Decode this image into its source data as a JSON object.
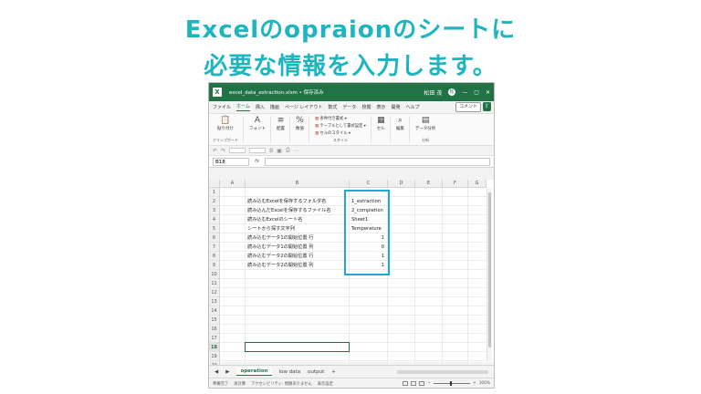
{
  "headline": {
    "line1": "Excelのopraionのシートに",
    "line2": "必要な情報を入力します。"
  },
  "window": {
    "filename": "excel_data_extraction.xlsm • 保存済み",
    "user": "松田 茂",
    "user_badge": "松",
    "controls": [
      "—",
      "▢",
      "✕"
    ]
  },
  "menu": {
    "tabs": [
      "ファイル",
      "ホーム",
      "挿入",
      "描画",
      "ページ レイアウト",
      "数式",
      "データ",
      "校閲",
      "表示",
      "開発",
      "ヘルプ"
    ],
    "active_tab": "ホーム",
    "comment_label": "コメント",
    "share_label": "⇧"
  },
  "ribbon": {
    "clipboard": {
      "group": "クリップボード",
      "paste": "貼り付け"
    },
    "font": {
      "label": "フォント",
      "glyph": "A"
    },
    "align": {
      "label": "配置",
      "glyph": "≡"
    },
    "number": {
      "label": "数値",
      "glyph": "%"
    },
    "styles": {
      "group": "スタイル",
      "items": [
        "条件付き書式 ▾",
        "テーブルとして書式設定 ▾",
        "セルのスタイル ▾"
      ]
    },
    "cells": {
      "label": "セル",
      "glyph": "▦"
    },
    "edit": {
      "label": "編集",
      "glyph": "⌕"
    },
    "analysis": {
      "label": "データ分析",
      "group": "分析",
      "glyph": "▤"
    }
  },
  "formula_bar": {
    "name_box": "B18",
    "fx": "fx",
    "value": ""
  },
  "columns": [
    "A",
    "B",
    "C",
    "D",
    "E",
    "F",
    "G"
  ],
  "rows": [
    "1",
    "2",
    "3",
    "4",
    "5",
    "6",
    "7",
    "8",
    "9",
    "10",
    "11",
    "12",
    "13",
    "14",
    "15",
    "16",
    "17",
    "18",
    "19",
    "20"
  ],
  "cells": {
    "b": [
      "",
      "読み込むExcelを保存するフォルダ名",
      "読み込んだExcelを保存するファイル名",
      "読み込むExcelのシート名",
      "シートから探す文字列",
      "読み込むデータ1の開始位置 行",
      "読み込むデータ1の開始位置 列",
      "読み込むデータ2の開始位置 行",
      "読み込むデータ2の開始位置 列"
    ],
    "c": [
      "",
      "1_extraction",
      "2_completion",
      "Sheet1",
      "Temperature",
      "1",
      "0",
      "1",
      "1"
    ]
  },
  "sheets": {
    "tabs": [
      "operation",
      "low data",
      "output"
    ],
    "active": "operation",
    "add": "+"
  },
  "status": {
    "ready": "準備完了",
    "calc": "再計算",
    "accessibility": "アクセシビリティ: 問題ありません",
    "display": "表示設定",
    "zoom": "100%"
  }
}
